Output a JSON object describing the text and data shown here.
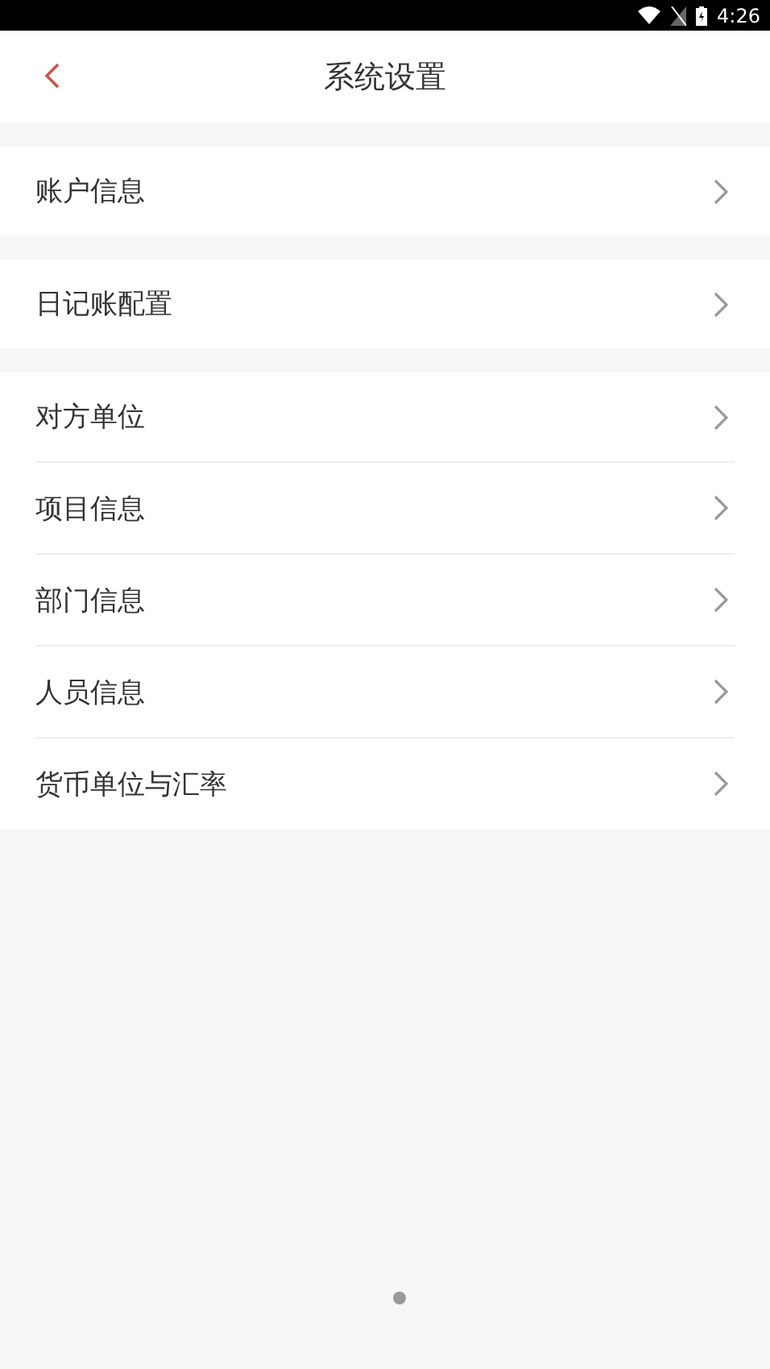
{
  "status_bar": {
    "time": "4:26"
  },
  "header": {
    "title": "系统设置"
  },
  "groups": [
    {
      "items": [
        {
          "label": "账户信息"
        }
      ]
    },
    {
      "items": [
        {
          "label": "日记账配置"
        }
      ]
    },
    {
      "items": [
        {
          "label": "对方单位"
        },
        {
          "label": "项目信息"
        },
        {
          "label": "部门信息"
        },
        {
          "label": "人员信息"
        },
        {
          "label": "货币单位与汇率"
        }
      ]
    }
  ]
}
